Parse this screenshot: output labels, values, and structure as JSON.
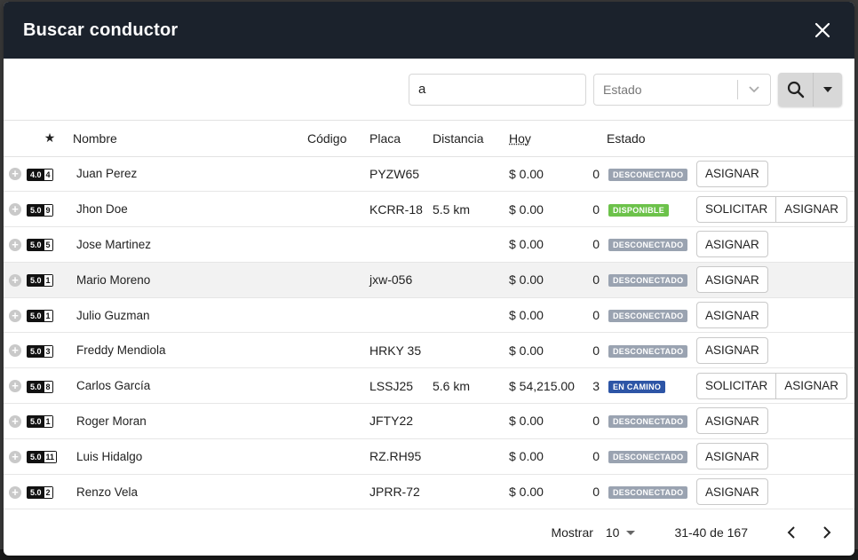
{
  "modal": {
    "title": "Buscar conductor"
  },
  "toolbar": {
    "search_value": "a",
    "state_placeholder": "Estado"
  },
  "table": {
    "headers": {
      "star": "★",
      "name": "Nombre",
      "code": "Código",
      "plate": "Placa",
      "distance": "Distancia",
      "today": "Hoy",
      "state": "Estado"
    },
    "rows": [
      {
        "rating": "4.0",
        "count": "4",
        "name": "Juan Perez",
        "code": "",
        "plate": "PYZW65",
        "distance": "",
        "today": "$ 0.00",
        "trips": "0",
        "status": "DESCONECTADO",
        "status_color": "#9aa3b1",
        "actions": [
          "ASIGNAR"
        ]
      },
      {
        "rating": "5.0",
        "count": "9",
        "name": "Jhon Doe",
        "code": "",
        "plate": "KCRR-18",
        "distance": "5.5 km",
        "today": "$ 0.00",
        "trips": "0",
        "status": "DISPONIBLE",
        "status_color": "#6cc24a",
        "actions": [
          "SOLICITAR",
          "ASIGNAR"
        ]
      },
      {
        "rating": "5.0",
        "count": "5",
        "name": "Jose Martinez",
        "code": "",
        "plate": "",
        "distance": "",
        "today": "$ 0.00",
        "trips": "0",
        "status": "DESCONECTADO",
        "status_color": "#9aa3b1",
        "actions": [
          "ASIGNAR"
        ]
      },
      {
        "rating": "5.0",
        "count": "1",
        "name": "Mario Moreno",
        "code": "",
        "plate": "jxw-056",
        "distance": "",
        "today": "$ 0.00",
        "trips": "0",
        "status": "DESCONECTADO",
        "status_color": "#9aa3b1",
        "actions": [
          "ASIGNAR"
        ]
      },
      {
        "rating": "5.0",
        "count": "1",
        "name": "Julio Guzman",
        "code": "",
        "plate": "",
        "distance": "",
        "today": "$ 0.00",
        "trips": "0",
        "status": "DESCONECTADO",
        "status_color": "#9aa3b1",
        "actions": [
          "ASIGNAR"
        ]
      },
      {
        "rating": "5.0",
        "count": "3",
        "name": "Freddy Mendiola",
        "code": "",
        "plate": "HRKY 35",
        "distance": "",
        "today": "$ 0.00",
        "trips": "0",
        "status": "DESCONECTADO",
        "status_color": "#9aa3b1",
        "actions": [
          "ASIGNAR"
        ]
      },
      {
        "rating": "5.0",
        "count": "8",
        "name": "Carlos García",
        "code": "",
        "plate": "LSSJ25",
        "distance": "5.6 km",
        "today": "$ 54,215.00",
        "trips": "3",
        "status": "EN CAMINO",
        "status_color": "#2d55a6",
        "actions": [
          "SOLICITAR",
          "ASIGNAR"
        ]
      },
      {
        "rating": "5.0",
        "count": "1",
        "name": "Roger Moran",
        "code": "",
        "plate": "JFTY22",
        "distance": "",
        "today": "$ 0.00",
        "trips": "0",
        "status": "DESCONECTADO",
        "status_color": "#9aa3b1",
        "actions": [
          "ASIGNAR"
        ]
      },
      {
        "rating": "5.0",
        "count": "11",
        "name": "Luis Hidalgo",
        "code": "",
        "plate": "RZ.RH95",
        "distance": "",
        "today": "$ 0.00",
        "trips": "0",
        "status": "DESCONECTADO",
        "status_color": "#9aa3b1",
        "actions": [
          "ASIGNAR"
        ]
      },
      {
        "rating": "5.0",
        "count": "2",
        "name": "Renzo Vela",
        "code": "",
        "plate": "JPRR-72",
        "distance": "",
        "today": "$ 0.00",
        "trips": "0",
        "status": "DESCONECTADO",
        "status_color": "#9aa3b1",
        "actions": [
          "ASIGNAR"
        ]
      }
    ]
  },
  "footer": {
    "show_label": "Mostrar",
    "page_size": "10",
    "range": "31-40 de 167"
  },
  "colors": {
    "header_bg": "#1b222c",
    "highlight_row": "#f2f2f2"
  }
}
